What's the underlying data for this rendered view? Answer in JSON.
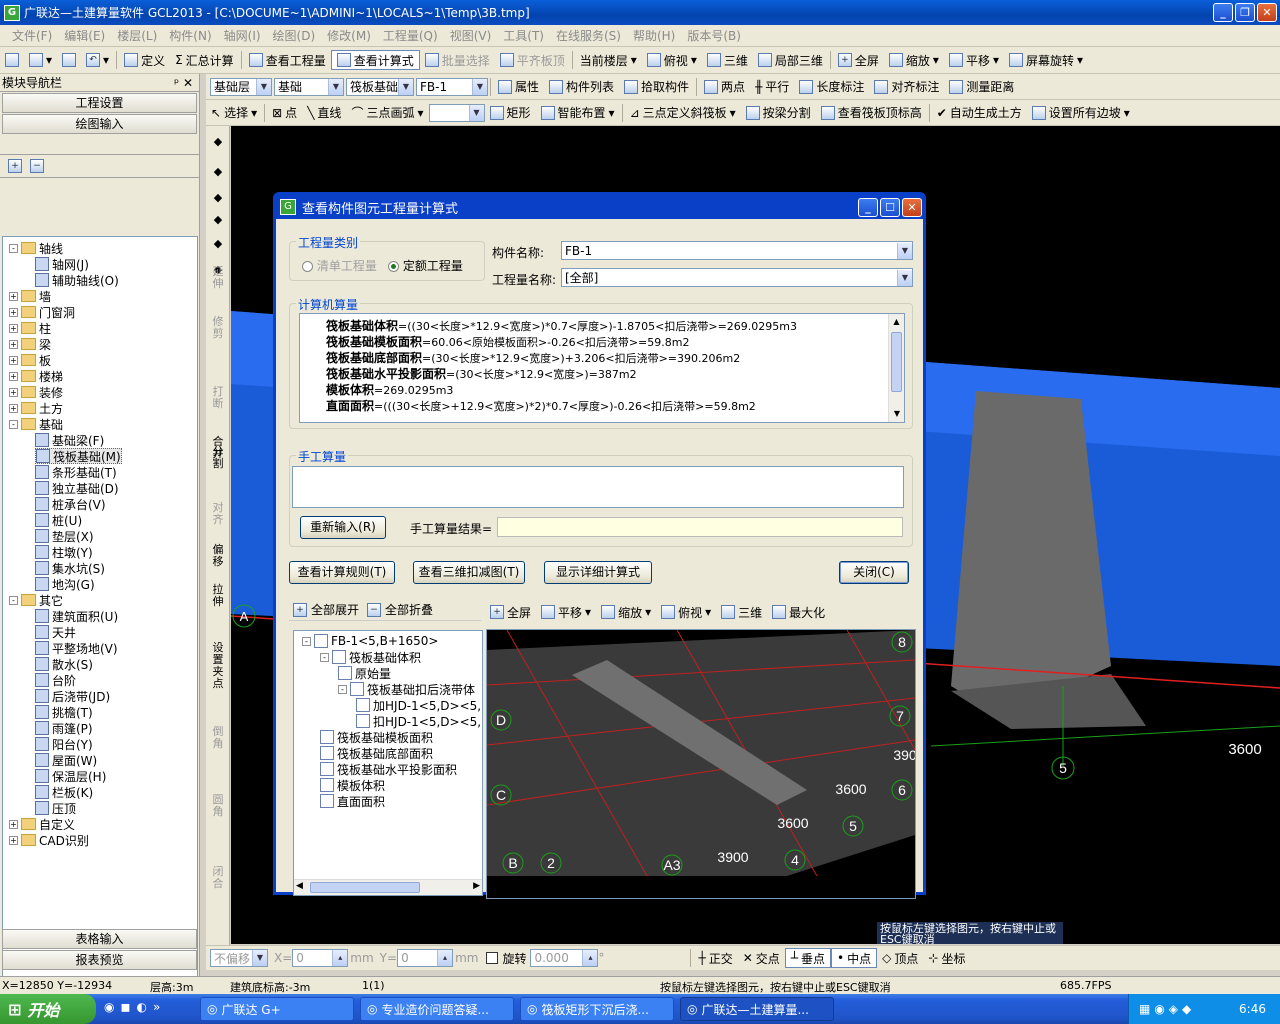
{
  "title": "广联达—土建算量软件 GCL2013 - [C:\\DOCUME~1\\ADMINI~1\\LOCALS~1\\Temp\\3B.tmp]",
  "menu": [
    "文件(F)",
    "编辑(E)",
    "楼层(L)",
    "构件(N)",
    "轴网(I)",
    "绘图(D)",
    "修改(M)",
    "工程量(Q)",
    "视图(V)",
    "工具(T)",
    "在线服务(S)",
    "帮助(H)",
    "版本号(B)"
  ],
  "toolbar1": {
    "define": "定义",
    "summary": "汇总计算",
    "view_qty": "查看工程量",
    "view_formula": "查看计算式",
    "batch_select": "批量选择",
    "flat_top": "平齐板顶",
    "current_floor": "当前楼层",
    "top_view": "俯视",
    "three_d": "三维",
    "local_3d": "局部三维",
    "fullscreen": "全屏",
    "zoom": "缩放",
    "pan": "平移",
    "rotate": "屏幕旋转"
  },
  "toolbar2": {
    "floor": "基础层",
    "category": "基础",
    "type": "筏板基础",
    "component": "FB-1",
    "props": "属性",
    "comp_list": "构件列表",
    "pick": "拾取构件",
    "two_point": "两点",
    "parallel": "平行",
    "length_mark": "长度标注",
    "align_mark": "对齐标注",
    "measure": "测量距离"
  },
  "toolbar3": {
    "select": "选择",
    "point": "点",
    "line": "直线",
    "arc": "三点画弧",
    "rect": "矩形",
    "smart": "智能布置",
    "slope": "三点定义斜筏板",
    "split": "按梁分割",
    "view_top": "查看筏板顶标高",
    "auto_earth": "自动生成土方",
    "set_slope": "设置所有边坡"
  },
  "nav": {
    "title": "模块导航栏",
    "project_settings": "工程设置",
    "drawing_input": "绘图输入",
    "table_input": "表格输入",
    "report_preview": "报表预览",
    "tree": [
      {
        "label": "轴线",
        "lv": 0,
        "exp": "-",
        "folder": true
      },
      {
        "label": "轴网(J)",
        "lv": 1
      },
      {
        "label": "辅助轴线(O)",
        "lv": 1
      },
      {
        "label": "墙",
        "lv": 0,
        "exp": "+",
        "folder": true
      },
      {
        "label": "门窗洞",
        "lv": 0,
        "exp": "+",
        "folder": true
      },
      {
        "label": "柱",
        "lv": 0,
        "exp": "+",
        "folder": true
      },
      {
        "label": "梁",
        "lv": 0,
        "exp": "+",
        "folder": true
      },
      {
        "label": "板",
        "lv": 0,
        "exp": "+",
        "folder": true
      },
      {
        "label": "楼梯",
        "lv": 0,
        "exp": "+",
        "folder": true
      },
      {
        "label": "装修",
        "lv": 0,
        "exp": "+",
        "folder": true
      },
      {
        "label": "土方",
        "lv": 0,
        "exp": "+",
        "folder": true
      },
      {
        "label": "基础",
        "lv": 0,
        "exp": "-",
        "folder": true
      },
      {
        "label": "基础梁(F)",
        "lv": 1
      },
      {
        "label": "筏板基础(M)",
        "lv": 1,
        "sel": true
      },
      {
        "label": "条形基础(T)",
        "lv": 1
      },
      {
        "label": "独立基础(D)",
        "lv": 1
      },
      {
        "label": "桩承台(V)",
        "lv": 1
      },
      {
        "label": "桩(U)",
        "lv": 1
      },
      {
        "label": "垫层(X)",
        "lv": 1
      },
      {
        "label": "柱墩(Y)",
        "lv": 1
      },
      {
        "label": "集水坑(S)",
        "lv": 1
      },
      {
        "label": "地沟(G)",
        "lv": 1
      },
      {
        "label": "其它",
        "lv": 0,
        "exp": "-",
        "folder": true
      },
      {
        "label": "建筑面积(U)",
        "lv": 1
      },
      {
        "label": "天井",
        "lv": 1
      },
      {
        "label": "平整场地(V)",
        "lv": 1
      },
      {
        "label": "散水(S)",
        "lv": 1
      },
      {
        "label": "台阶",
        "lv": 1
      },
      {
        "label": "后浇带(JD)",
        "lv": 1
      },
      {
        "label": "挑檐(T)",
        "lv": 1
      },
      {
        "label": "雨篷(P)",
        "lv": 1
      },
      {
        "label": "阳台(Y)",
        "lv": 1
      },
      {
        "label": "屋面(W)",
        "lv": 1
      },
      {
        "label": "保温层(H)",
        "lv": 1
      },
      {
        "label": "栏板(K)",
        "lv": 1
      },
      {
        "label": "压顶",
        "lv": 1
      },
      {
        "label": "自定义",
        "lv": 0,
        "exp": "+",
        "folder": true
      },
      {
        "label": "CAD识别",
        "lv": 0,
        "exp": "+",
        "folder": true
      }
    ]
  },
  "vtools": [
    "延伸",
    "修剪",
    "打断",
    "合并",
    "分割",
    "对齐",
    "偏移",
    "拉伸",
    "设置夹点",
    "倒角",
    "圆角",
    "闭合"
  ],
  "viewport": {
    "labels": [
      "3600",
      "5",
      "A"
    ],
    "hint": "按鼠标左键选择图元，按右键中止或ESC键取消"
  },
  "dialog": {
    "title": "查看构件图元工程量计算式",
    "qty_type": "工程量类别",
    "list_qty": "清单工程量",
    "quota_qty": "定额工程量",
    "comp_name_label": "构件名称:",
    "comp_name_value": "FB-1",
    "qty_name_label": "工程量名称:",
    "qty_name_value": "[全部]",
    "computer_calc": "计算机算量",
    "formulas": [
      {
        "name": "筏板基础体积",
        "expr": "=((30<长度>*12.9<宽度>)*0.7<厚度>)-1.8705<扣后浇带>=269.0295m3"
      },
      {
        "name": "筏板基础模板面积",
        "expr": "=60.06<原始模板面积>-0.26<扣后浇带>=59.8m2"
      },
      {
        "name": "筏板基础底部面积",
        "expr": "=(30<长度>*12.9<宽度>)+3.206<扣后浇带>=390.206m2"
      },
      {
        "name": "筏板基础水平投影面积",
        "expr": "=(30<长度>*12.9<宽度>)=387m2"
      },
      {
        "name": "模板体积",
        "expr": "=269.0295m3"
      },
      {
        "name": "直面面积",
        "expr": "=(((30<长度>+12.9<宽度>)*2)*0.7<厚度>)-0.26<扣后浇带>=59.8m2"
      }
    ],
    "manual_calc": "手工算量",
    "reenter": "重新输入(R)",
    "manual_result_label": "手工算量结果=",
    "btn_rules": "查看计算规则(T)",
    "btn_3d": "查看三维扣减图(T)",
    "btn_detail": "显示详细计算式",
    "btn_close": "关闭(C)",
    "expand_all": "全部展开",
    "collapse_all": "全部折叠",
    "ctree": [
      {
        "label": "FB-1<5,B+1650>",
        "lv": 0,
        "exp": "-"
      },
      {
        "label": "筏板基础体积",
        "lv": 1,
        "exp": "-"
      },
      {
        "label": "原始量",
        "lv": 2
      },
      {
        "label": "筏板基础扣后浇带体",
        "lv": 2,
        "exp": "-"
      },
      {
        "label": "加HJD-1<5,D><5,",
        "lv": 3
      },
      {
        "label": "扣HJD-1<5,D><5,",
        "lv": 3
      },
      {
        "label": "筏板基础模板面积",
        "lv": 1
      },
      {
        "label": "筏板基础底部面积",
        "lv": 1
      },
      {
        "label": "筏板基础水平投影面积",
        "lv": 1
      },
      {
        "label": "模板体积",
        "lv": 1
      },
      {
        "label": "直面面积",
        "lv": 1
      }
    ],
    "pv_fullscreen": "全屏",
    "pv_pan": "平移",
    "pv_zoom": "缩放",
    "pv_top": "俯视",
    "pv_3d": "三维",
    "pv_max": "最大化",
    "pv_labels": [
      "8",
      "7",
      "6",
      "5",
      "4",
      "D",
      "C",
      "B",
      "2",
      "A3",
      "390",
      "3600",
      "3600",
      "3900"
    ]
  },
  "status_row": {
    "no_offset": "不偏移",
    "x": "X=",
    "y": "Y=",
    "x_val": "0",
    "y_val": "0",
    "mm": "mm",
    "rotate": "旋转",
    "angle": "0.000",
    "ortho": "正交",
    "intersect": "交点",
    "perp": "垂点",
    "mid": "中点",
    "vertex": "顶点",
    "coord": "坐标"
  },
  "statusbar": {
    "coords": "X=12850 Y=-12934",
    "floor_h": "层高:3m",
    "bottom": "建筑底标高:-3m",
    "sel": "1(1)",
    "hint": "按鼠标左键选择图元，按右键中止或ESC键取消",
    "fps": "685.7FPS"
  },
  "taskbar": {
    "start": "开始",
    "tasks": [
      "广联达 G+",
      "专业造价问题答疑...",
      "筏板矩形下沉后浇...",
      "广联达—土建算量..."
    ],
    "time": "6:46"
  }
}
